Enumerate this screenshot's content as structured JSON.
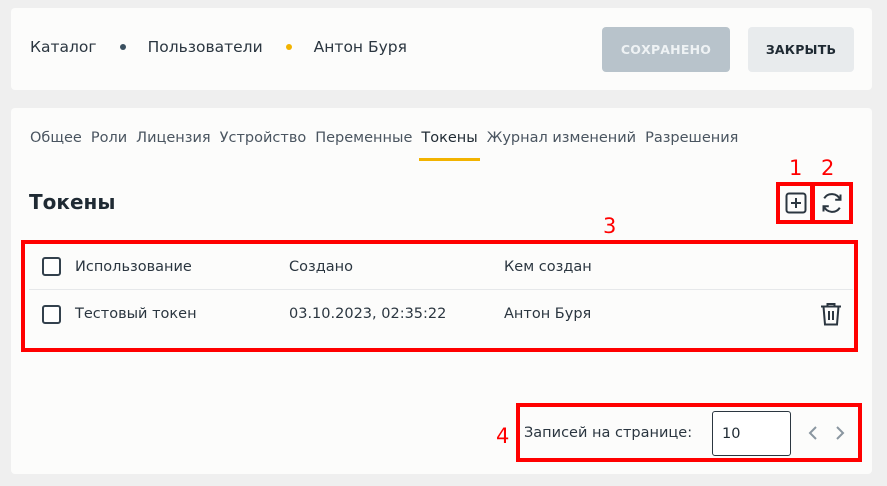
{
  "breadcrumb": {
    "items": [
      "Каталог",
      "Пользователи",
      "Антон Буря"
    ]
  },
  "header": {
    "saved_label": "СОХРАНЕНО",
    "close_label": "ЗАКРЫТЬ"
  },
  "tabs": [
    {
      "label": "Общее"
    },
    {
      "label": "Роли"
    },
    {
      "label": "Лицензия"
    },
    {
      "label": "Устройство"
    },
    {
      "label": "Переменные"
    },
    {
      "label": "Токены",
      "active": true
    },
    {
      "label": "Журнал изменений"
    },
    {
      "label": "Разрешения"
    }
  ],
  "section": {
    "title": "Токены"
  },
  "toolbar": {
    "add_icon": "plus-square-icon",
    "refresh_icon": "refresh-icon"
  },
  "table": {
    "columns": [
      "Использование",
      "Создано",
      "Кем создан"
    ],
    "rows": [
      {
        "usage": "Тестовый токен",
        "created": "03.10.2023, 02:35:22",
        "created_by": "Антон Буря"
      }
    ]
  },
  "pagination": {
    "label": "Записей на странице:",
    "page_size": "10"
  },
  "annotations": {
    "labels": [
      "1",
      "2",
      "3",
      "4"
    ]
  },
  "colors": {
    "accent": "#f2b300",
    "annotation": "#ff0000",
    "disabled_button": "#b8c3cb"
  }
}
